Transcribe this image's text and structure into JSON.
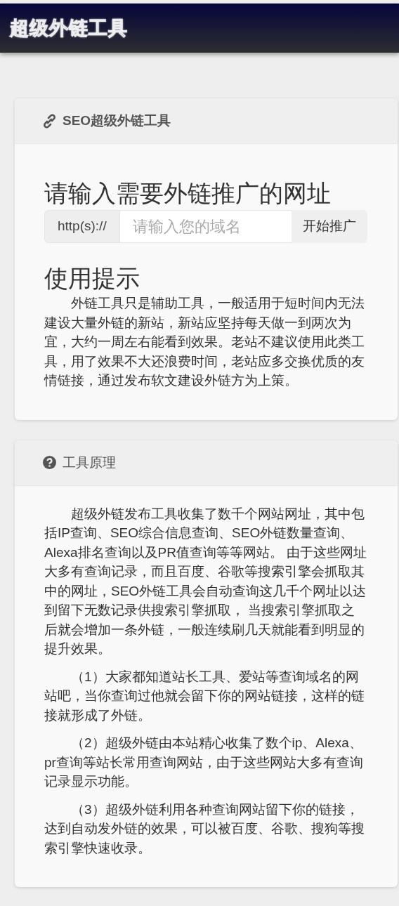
{
  "navbar": {
    "brand": "超级外链工具"
  },
  "tool_card": {
    "header": "SEO超级外链工具",
    "heading": "请输入需要外链推广的网址",
    "prefix": "http(s)://",
    "input": {
      "placeholder": "请输入您的域名"
    },
    "button": "开始推广",
    "tips_heading": "使用提示",
    "tips": "外链工具只是辅助工具，一般适用于短时间内无法建设大量外链的新站，新站应坚持每天做一到两次为宜，大约一周左右能看到效果。老站不建议使用此类工具，用了效果不大还浪费时间，老站应多交换优质的友情链接，通过发布软文建设外链方为上策。"
  },
  "principle_card": {
    "header": "工具原理",
    "paragraphs": [
      "超级外链发布工具收集了数千个网站网址，其中包括IP查询、SEO综合信息查询、SEO外链数量查询、Alexa排名查询以及PR值查询等等网站。 由于这些网址大多有查询记录，而且百度、谷歌等搜索引擎会抓取其中的网址，SEO外链工具会自动查询这几千个网址以达到留下无数记录供搜索引擎抓取， 当搜索引擎抓取之后就会增加一条外链，一般连续刷几天就能看到明显的提升效果。",
      "（1）大家都知道站长工具、爱站等查询域名的网站吧，当你查询过他就会留下你的网站链接，这样的链接就形成了外链。",
      "（2）超级外链由本站精心收集了数个ip、Alexa、pr查询等站长常用查询网站，由于这些网站大多有查询记录显示功能。",
      "（3）超级外链利用各种查询网站留下你的链接，达到自动发外链的效果，可以被百度、谷歌、搜狗等搜索引擎快速收录。"
    ]
  }
}
